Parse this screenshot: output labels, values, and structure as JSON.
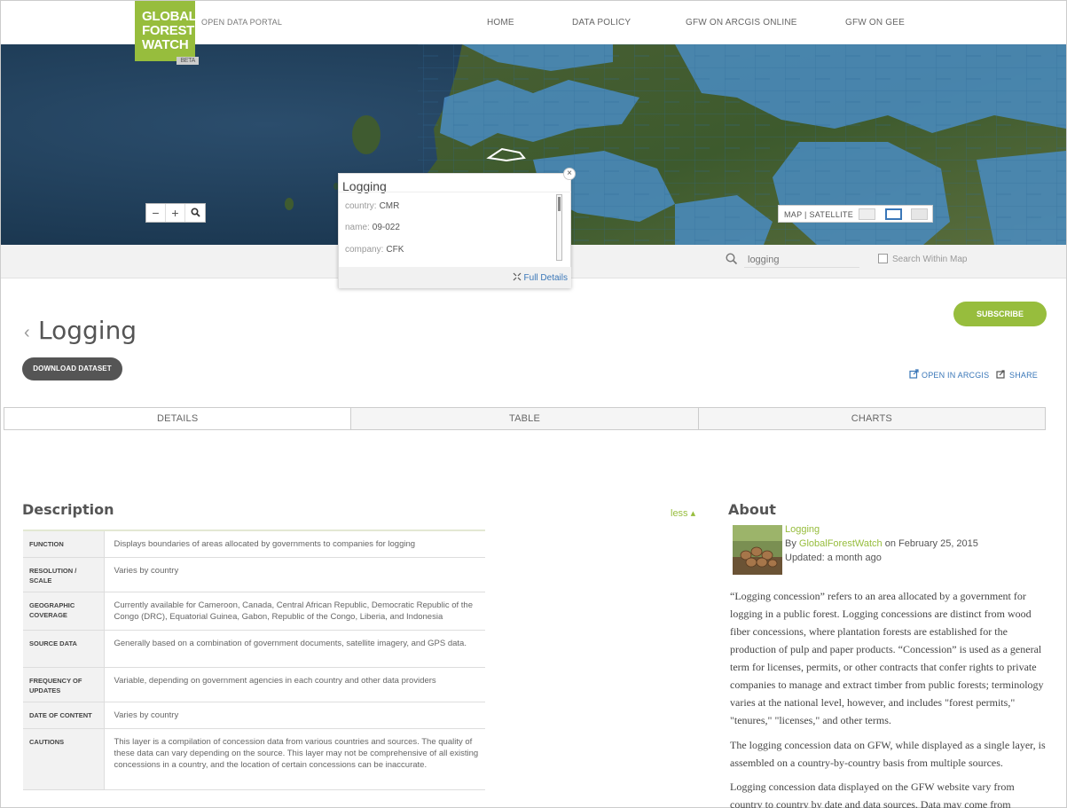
{
  "logo": {
    "line1": "GLOBAL",
    "line2": "FOREST",
    "line3": "WATCH",
    "badge": "BETA"
  },
  "header": {
    "portal_label": "OPEN DATA PORTAL",
    "nav": [
      "HOME",
      "DATA POLICY",
      "GFW ON ARCGIS ONLINE",
      "GFW ON GEE"
    ]
  },
  "map": {
    "zoom": {
      "out": "−",
      "in": "+"
    },
    "basemap_label": "MAP | SATELLITE",
    "colors": {
      "ocean": "#1d3a52",
      "concession": "#4a8cc2",
      "land": "#3c5a2c"
    }
  },
  "popup": {
    "title": "Logging",
    "close": "×",
    "rows": [
      {
        "key": "country:",
        "value": "CMR"
      },
      {
        "key": "name:",
        "value": "09-022"
      },
      {
        "key": "company:",
        "value": "CFK"
      }
    ],
    "full_details": "Full Details"
  },
  "search": {
    "value": "logging",
    "within_label": "Search Within Map"
  },
  "dataset": {
    "back": "‹",
    "title": "Logging",
    "download_label": "DOWNLOAD DATASET",
    "subscribe_label": "SUBSCRIBE",
    "open_in_arcgis": "OPEN IN ARCGIS",
    "share": "SHARE"
  },
  "tabs": [
    "DETAILS",
    "TABLE",
    "CHARTS"
  ],
  "description": {
    "title": "Description",
    "less": "less ▴",
    "rows": [
      {
        "key": "FUNCTION",
        "value": "Displays boundaries of areas allocated by governments to companies for logging"
      },
      {
        "key": "RESOLUTION / SCALE",
        "value": "Varies by country"
      },
      {
        "key": "GEOGRAPHIC COVERAGE",
        "value": "Currently available for Cameroon, Canada, Central African Republic, Democratic Republic of the Congo (DRC), Equatorial Guinea, Gabon, Republic of the Congo, Liberia, and Indonesia"
      },
      {
        "key": "SOURCE DATA",
        "value": "Generally based on a combination of government documents, satellite imagery, and GPS data."
      },
      {
        "key": "FREQUENCY OF UPDATES",
        "value": "Variable, depending on government agencies in each country and other data providers"
      },
      {
        "key": "DATE OF CONTENT",
        "value": "Varies by country"
      },
      {
        "key": "CAUTIONS",
        "value": "This layer is a compilation of concession data from various countries and sources. The quality of these data can vary depending on the source. This layer may not be comprehensive of all existing concessions in a country, and the location of certain concessions can be inaccurate."
      }
    ]
  },
  "about": {
    "title": "About",
    "name": "Logging",
    "by_prefix": "By",
    "author": "GlobalForestWatch",
    "date": "on February 25, 2015",
    "updated": "Updated: a month ago",
    "paragraphs": [
      "“Logging concession” refers to an area allocated by a government for logging in a public forest. Logging concessions are distinct from wood fiber concessions, where plantation forests are established for the production of pulp and paper products. “Concession” is used as a general term for licenses, permits, or other contracts that confer rights to private companies to manage and extract timber from public forests; terminology varies at the national level, however, and includes \"forest permits,\" \"tenures,\" \"licenses,\" and other terms.",
      "The logging concession data on GFW, while displayed as a single layer, is assembled on a country-by-country basis from multiple sources.",
      "Logging concession data displayed on the GFW website vary from country to country by date and data sources. Data may come from government"
    ]
  }
}
